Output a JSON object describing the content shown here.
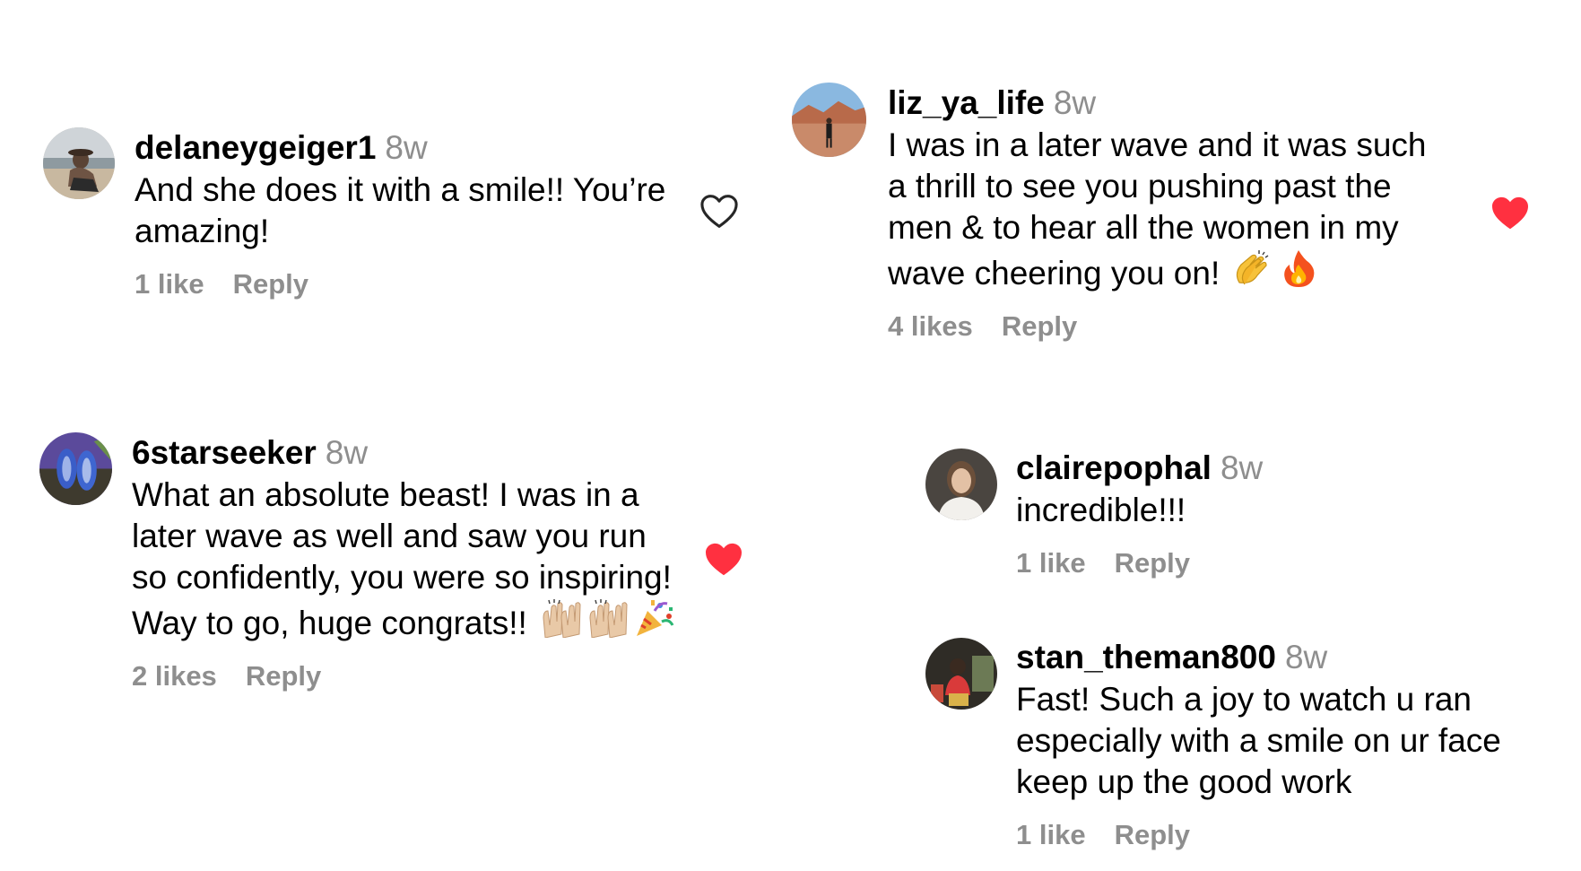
{
  "comments": [
    {
      "username": "delaneygeiger1",
      "time": "8w",
      "lines": [
        "And she does it with a smile!! You’re",
        "amazing!"
      ],
      "likes": "1 like",
      "reply": "Reply",
      "liked": false
    },
    {
      "username": "6starseeker",
      "time": "8w",
      "lines": [
        "What an absolute beast! I was in a",
        "later wave as well and saw you run",
        "so confidently, you were so inspiring!",
        "Way to go, huge congrats!!"
      ],
      "emoji": [
        "raising-hands-icon",
        "raising-hands-icon",
        "party-popper-icon"
      ],
      "likes": "2 likes",
      "reply": "Reply",
      "liked": true
    },
    {
      "username": "liz_ya_life",
      "time": "8w",
      "lines": [
        "I was in a later wave and it was such",
        "a thrill to see you pushing past the",
        "men & to hear all the women in my",
        "wave cheering you on!"
      ],
      "emoji": [
        "clapping-hands-icon",
        "fire-icon"
      ],
      "likes": "4 likes",
      "reply": "Reply",
      "liked": true
    },
    {
      "username": "clairepophal",
      "time": "8w",
      "lines": [
        "incredible!!!"
      ],
      "likes": "1 like",
      "reply": "Reply"
    },
    {
      "username": "stan_theman800",
      "time": "8w",
      "lines": [
        "Fast! Such a joy to watch u ran",
        "especially with a smile on ur face",
        "keep up the good work"
      ],
      "likes": "1 like",
      "reply": "Reply"
    }
  ],
  "colors": {
    "liked_heart": "#ff3040",
    "unliked_heart": "#262626",
    "muted_text": "#8e8e8e"
  }
}
